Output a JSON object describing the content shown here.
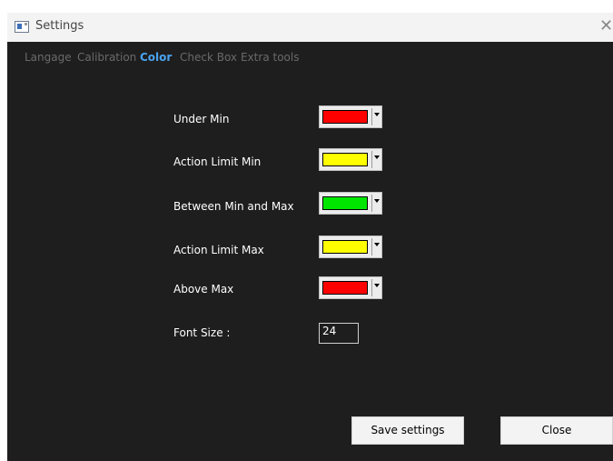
{
  "window": {
    "title": "Settings"
  },
  "tabs": [
    {
      "label": "Langage",
      "active": false
    },
    {
      "label": "Calibration",
      "active": false
    },
    {
      "label": "Color",
      "active": true
    },
    {
      "label": "Check Box",
      "active": false
    },
    {
      "label": "Extra tools",
      "active": false
    }
  ],
  "color_settings": [
    {
      "label": "Under Min",
      "color": "#ff0000"
    },
    {
      "label": "Action Limit Min",
      "color": "#ffff00"
    },
    {
      "label": "Between Min and Max",
      "color": "#00e600"
    },
    {
      "label": "Action Limit Max",
      "color": "#ffff00"
    },
    {
      "label": "Above Max",
      "color": "#ff0000"
    }
  ],
  "font_size": {
    "label": "Font Size :",
    "value": "24"
  },
  "buttons": {
    "save_label": "Save settings",
    "close_label": "Close"
  },
  "icons": {
    "app": "settings-app-icon",
    "close": "close-icon",
    "dropdown": "chevron-down-icon"
  }
}
